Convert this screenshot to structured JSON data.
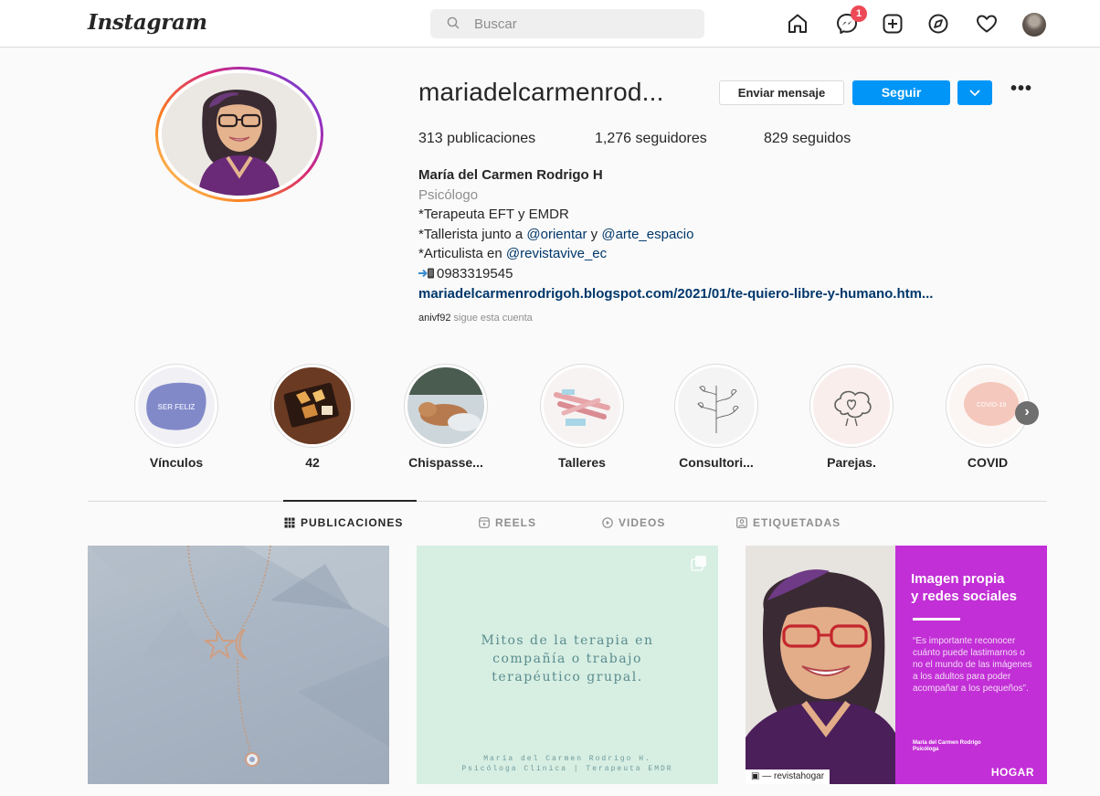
{
  "nav": {
    "logo": "Instagram",
    "search_placeholder": "Buscar",
    "notification_count": "1",
    "icons": [
      "home-icon",
      "messenger-icon",
      "new-post-icon",
      "explore-icon",
      "heart-icon",
      "profile-avatar"
    ]
  },
  "profile": {
    "username": "mariadelcarmenrod...",
    "message_button": "Enviar mensaje",
    "follow_button": "Seguir",
    "more": "•••",
    "stats": {
      "posts_count": "313",
      "posts_label": "publicaciones",
      "followers_count": "1,276",
      "followers_label": "seguidores",
      "following_count": "829",
      "following_label": "seguidos"
    },
    "full_name": "María del Carmen Rodrigo H",
    "category": "Psicólogo",
    "bio_line1": "*Terapeuta EFT y EMDR",
    "bio_line2_prefix": "*Tallerista junto a ",
    "bio_line2_mention1": "@orientar",
    "bio_line2_mid": " y ",
    "bio_line2_mention2": "@arte_espacio",
    "bio_line3_prefix": "*Articulista en ",
    "bio_line3_mention": "@revistavive_ec",
    "phone": "0983319545",
    "website": "mariadelcarmenrodrigoh.blogspot.com/2021/01/te-quiero-libre-y-humano.htm...",
    "followed_by_user": "anivf92",
    "followed_by_text": " sigue esta cuenta"
  },
  "highlights": [
    {
      "label": "Vínculos",
      "cover_text": "SER FELIZ"
    },
    {
      "label": "42",
      "cover_text": ""
    },
    {
      "label": "Chispasse...",
      "cover_text": ""
    },
    {
      "label": "Talleres",
      "cover_text": ""
    },
    {
      "label": "Consultori...",
      "cover_text": ""
    },
    {
      "label": "Parejas.",
      "cover_text": ""
    },
    {
      "label": "COVID",
      "cover_text": "COVID-19"
    }
  ],
  "tabs": [
    {
      "label": "PUBLICACIONES",
      "active": true
    },
    {
      "label": "REELS",
      "active": false
    },
    {
      "label": "VIDEOS",
      "active": false
    },
    {
      "label": "ETIQUETADAS",
      "active": false
    }
  ],
  "posts": {
    "post2_text": "Mitos de la terapia en compañía o trabajo terapéutico grupal.",
    "post2_footer_line1": "María del Carmen Rodrigo H.",
    "post2_footer_line2": "Psicóloga Clínica | Terapeuta EMDR",
    "post3_title_line1": "Imagen propia",
    "post3_title_line2": "y redes sociales",
    "post3_quote": "“Es importante reconocer cuánto puede lastimarnos o no el mundo de las imágenes a los adultos para poder acompañar a los pequeños”.",
    "post3_sig_line1": "María del Carmen Rodrigo",
    "post3_sig_line2": "Psicóloga",
    "post3_brand": "HOGAR",
    "post3_tag": "revistahogar"
  },
  "colors": {
    "accent": "#0095f6",
    "link": "#00376b",
    "muted": "#8e8e8e",
    "badge": "#ed4956",
    "post3_panel": "#c22fd6"
  }
}
